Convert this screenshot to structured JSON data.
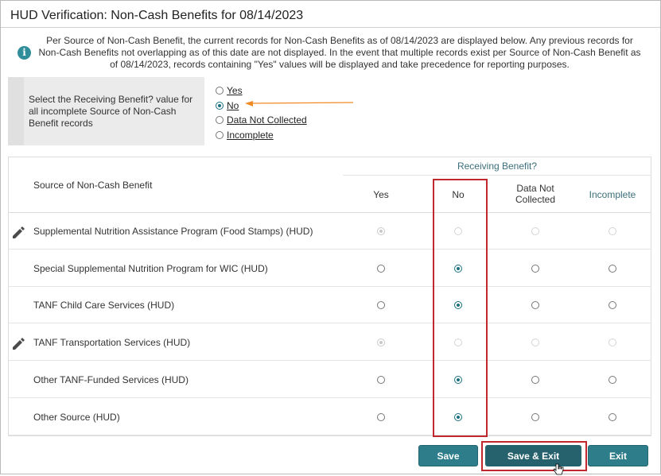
{
  "dialog": {
    "title": "HUD Verification: Non-Cash Benefits for 08/14/2023",
    "info_text": "Per Source of Non-Cash Benefit, the current records for Non-Cash Benefits as of 08/14/2023 are displayed below. Any previous records for Non-Cash Benefits not overlapping as of this date are not displayed. In the event that multiple records exist per Source of Non-Cash Benefit as of 08/14/2023, records containing \"Yes\" values will be displayed and take precedence for reporting purposes."
  },
  "bulk_select": {
    "label": "Select the Receiving Benefit? value for all incomplete Source of Non-Cash Benefit records",
    "options": [
      "Yes",
      "No",
      "Data Not Collected",
      "Incomplete"
    ],
    "selected": "No"
  },
  "table": {
    "group_header": "Receiving Benefit?",
    "source_header": "Source of Non-Cash Benefit",
    "columns": [
      "Yes",
      "No",
      "Data Not\nCollected",
      "Incomplete"
    ],
    "rows": [
      {
        "name": "Supplemental Nutrition Assistance Program (Food Stamps) (HUD)",
        "editable_icon": true,
        "selected": "Yes",
        "disabled": true
      },
      {
        "name": "Special Supplemental Nutrition Program for WIC (HUD)",
        "editable_icon": false,
        "selected": "No",
        "disabled": false
      },
      {
        "name": "TANF Child Care Services (HUD)",
        "editable_icon": false,
        "selected": "No",
        "disabled": false
      },
      {
        "name": "TANF Transportation Services (HUD)",
        "editable_icon": true,
        "selected": "Yes",
        "disabled": true
      },
      {
        "name": "Other TANF-Funded Services (HUD)",
        "editable_icon": false,
        "selected": "No",
        "disabled": false
      },
      {
        "name": "Other Source (HUD)",
        "editable_icon": false,
        "selected": "No",
        "disabled": false
      }
    ]
  },
  "buttons": {
    "save": "Save",
    "save_exit": "Save & Exit",
    "exit": "Exit"
  },
  "icons": {
    "info": "info-icon",
    "edit": "pencil-icon",
    "cursor": "hand-pointer-icon"
  },
  "colors": {
    "accent": "#2d7d8a",
    "highlight": "#c0282d",
    "arrow": "#f08a24"
  }
}
